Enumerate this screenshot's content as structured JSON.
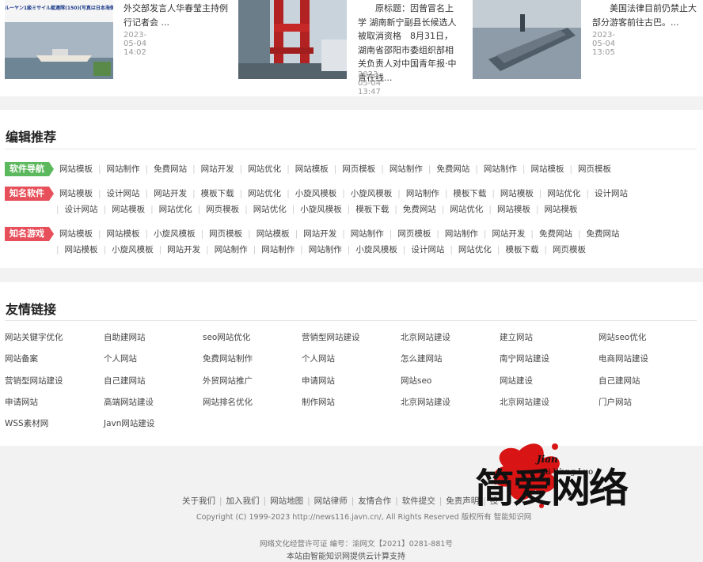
{
  "news": [
    {
      "text": "外交部发言人华春莹主持例行记者会 ...",
      "date": "2023-05-04 14:02"
    },
    {
      "text": "原标题：因曾冒名上学 湖南新宁副县长候选人被取消资格　8月31日，湖南省邵阳市委组织部相关负责人对中国青年报·中青在线...",
      "date": "2023-05-04 13:47"
    },
    {
      "text": "美国法律目前仍禁止大部分游客前往古巴。...",
      "date": "2023-05-04 13:05"
    }
  ],
  "thumb_caption": "ルーヤン1級ミサイル艇連隊(150)(写真は日本海側)",
  "editor": {
    "title": "编辑推荐",
    "groups": [
      {
        "tag": "软件导航",
        "color": "green",
        "rows": [
          [
            "网站模板",
            "网站制作",
            "免费网站",
            "网站开发",
            "网站优化",
            "网站模板",
            "网页模板",
            "网站制作",
            "免费网站",
            "网站制作",
            "网站模板",
            "网页模板"
          ]
        ]
      },
      {
        "tag": "知名软件",
        "color": "red",
        "rows": [
          [
            "网站模板",
            "设计网站",
            "网站开发",
            "模板下载",
            "网站优化",
            "小旋风模板",
            "小旋风模板",
            "网站制作",
            "模板下载",
            "网站模板",
            "网站优化",
            "设计网站"
          ],
          [
            "设计网站",
            "网站模板",
            "网站优化",
            "网页模板",
            "网站优化",
            "小旋风模板",
            "模板下载",
            "免费网站",
            "网站优化",
            "网站模板",
            "网站模板"
          ]
        ]
      },
      {
        "tag": "知名游戏",
        "color": "red",
        "rows": [
          [
            "网站模板",
            "网站模板",
            "小旋风模板",
            "网页模板",
            "网站模板",
            "网站开发",
            "网站制作",
            "网页模板",
            "网站制作",
            "网站开发",
            "免费网站",
            "免费网站"
          ],
          [
            "网站模板",
            "小旋风模板",
            "网站开发",
            "网站制作",
            "网站制作",
            "网站制作",
            "小旋风模板",
            "设计网站",
            "网站优化",
            "模板下载",
            "网页模板"
          ]
        ]
      }
    ]
  },
  "friends": {
    "title": "友情链接",
    "links": [
      "网站关键字优化",
      "自助建网站",
      "seo网站优化",
      "营销型网站建设",
      "北京网站建设",
      "建立网站",
      "网站seo优化",
      "网站备案",
      "个人网站",
      "免费网站制作",
      "个人网站",
      "怎么建网站",
      "南宁网站建设",
      "电商网站建设",
      "营销型网站建设",
      "自己建网站",
      "外贸网站推广",
      "申请网站",
      "网站seo",
      "网站建设",
      "自己建网站",
      "申请网站",
      "高端网站建设",
      "网站排名优化",
      "制作网站",
      "北京网站建设",
      "北京网站建设",
      "门户网站",
      "WSS素材网",
      "Javn网站建设"
    ]
  },
  "footer": {
    "links": [
      "关于我们",
      "加入我们",
      "网站地图",
      "网站律师",
      "友情合作",
      "软件提交",
      "免责声明",
      "投"
    ],
    "copyright": "Copyright (C) 1999-2023 http://news116.javn.cn/, All Rights Reserved 版权所有 智能知识网",
    "license": "网络文化经营许可证 编号：渝网文【2021】0281-881号",
    "support": "本站由智能知识网提供云计算支持"
  },
  "watermark": {
    "script1": "Jian",
    "script2": "Ai Wang Luo",
    "big": "简爱网络"
  }
}
